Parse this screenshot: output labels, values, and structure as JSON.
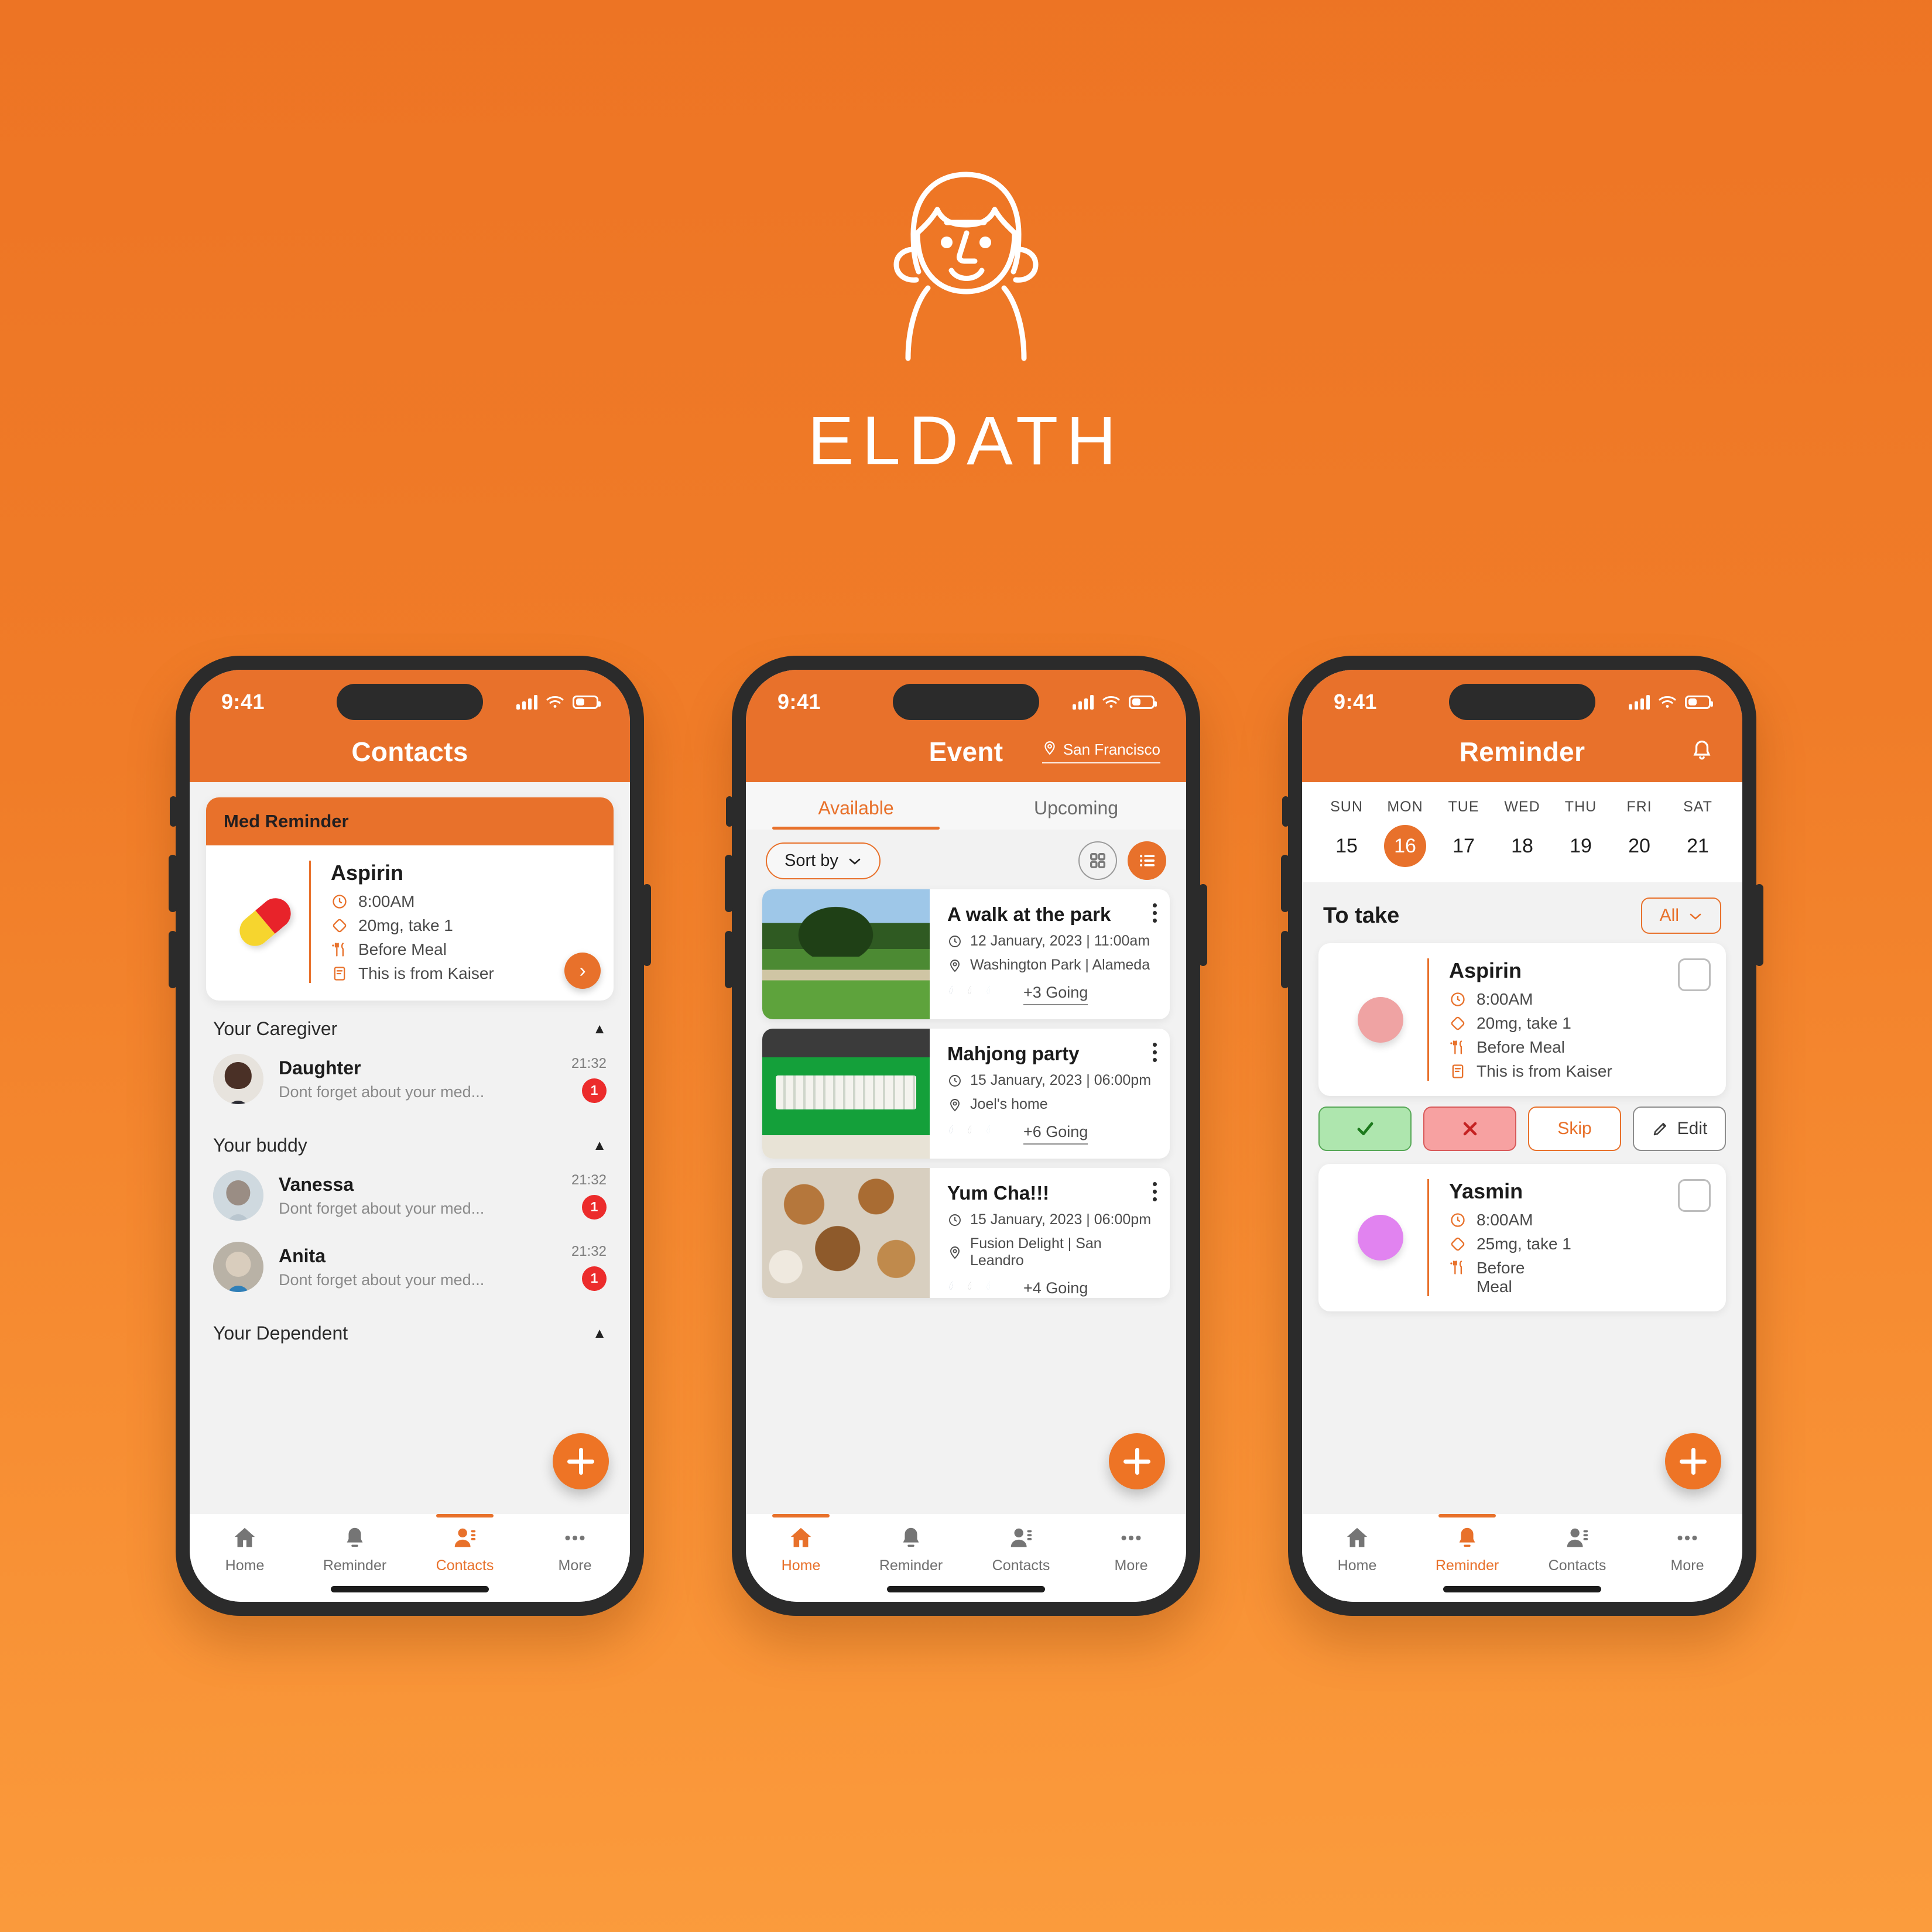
{
  "brand": {
    "name": "ELDATH",
    "logo_icon": "elderly-person-line-icon",
    "bg_top": "#ED7424",
    "bg_bottom": "#FB9C3D",
    "accent": "#E8712B"
  },
  "status_bar": {
    "time": "9:41",
    "signal_icon": "cellular-bars-icon",
    "wifi_icon": "wifi-icon",
    "battery_icon": "battery-icon"
  },
  "nav": {
    "items": [
      {
        "label": "Home",
        "icon": "home-icon"
      },
      {
        "label": "Reminder",
        "icon": "bell-icon"
      },
      {
        "label": "Contacts",
        "icon": "contacts-icon"
      },
      {
        "label": "More",
        "icon": "ellipsis-icon"
      }
    ]
  },
  "screen1": {
    "title": "Contacts",
    "active_nav": "Contacts",
    "med_reminder": {
      "header": "Med Reminder",
      "pill_icon": "capsule-pill-icon",
      "name": "Aspirin",
      "time": "8:00AM",
      "dose": "20mg, take 1",
      "meal": "Before Meal",
      "note": "This is from Kaiser",
      "chevron_icon": "chevron-right-icon"
    },
    "groups": [
      {
        "title": "Your Caregiver",
        "caret_icon": "caret-up-icon",
        "contacts": [
          {
            "name": "Daughter",
            "message": "Dont forget about your med...",
            "time": "21:32",
            "badge": "1",
            "avatar": "avatar-daughter"
          }
        ]
      },
      {
        "title": "Your buddy",
        "caret_icon": "caret-up-icon",
        "contacts": [
          {
            "name": "Vanessa",
            "message": "Dont forget about your med...",
            "time": "21:32",
            "badge": "1",
            "avatar": "avatar-vanessa"
          },
          {
            "name": "Anita",
            "message": "Dont forget about your med...",
            "time": "21:32",
            "badge": "1",
            "avatar": "avatar-anita"
          }
        ]
      },
      {
        "title": "Your Dependent",
        "caret_icon": "caret-up-icon",
        "contacts": []
      }
    ],
    "fab_icon": "plus-icon"
  },
  "screen2": {
    "title": "Event",
    "location": "San Francisco",
    "location_icon": "map-pin-icon",
    "active_nav": "Home",
    "tabs": [
      {
        "label": "Available",
        "active": true
      },
      {
        "label": "Upcoming",
        "active": false
      }
    ],
    "sort_by": "Sort by",
    "sort_caret_icon": "chevron-down-icon",
    "view_grid_icon": "grid-view-icon",
    "view_list_icon": "list-view-icon",
    "events": [
      {
        "title": "A walk at the park",
        "datetime": "12 January, 2023 | 11:00am",
        "place": "Washington Park | Alameda",
        "going": "+3 Going",
        "thumb": "park-photo",
        "clock_icon": "clock-icon",
        "pin_icon": "map-pin-icon",
        "menu_icon": "kebab-menu-icon"
      },
      {
        "title": "Mahjong party",
        "datetime": "15 January, 2023 | 06:00pm",
        "place": "Joel's home",
        "going": "+6 Going",
        "thumb": "mahjong-photo",
        "clock_icon": "clock-icon",
        "pin_icon": "map-pin-icon",
        "menu_icon": "kebab-menu-icon"
      },
      {
        "title": "Yum Cha!!!",
        "datetime": "15 January, 2023 | 06:00pm",
        "place": "Fusion Delight | San Leandro",
        "going": "+4 Going",
        "thumb": "dimsum-photo",
        "clock_icon": "clock-icon",
        "pin_icon": "map-pin-icon",
        "menu_icon": "kebab-menu-icon"
      }
    ],
    "fab_icon": "plus-icon"
  },
  "screen3": {
    "title": "Reminder",
    "bell_icon": "bell-outline-icon",
    "active_nav": "Reminder",
    "calendar": {
      "days": [
        "SUN",
        "MON",
        "TUE",
        "WED",
        "THU",
        "FRI",
        "SAT"
      ],
      "dates": [
        "15",
        "16",
        "17",
        "18",
        "19",
        "20",
        "21"
      ],
      "selected_index": 1
    },
    "section_title": "To take",
    "filter": "All",
    "filter_caret_icon": "chevron-down-icon",
    "meds": [
      {
        "name": "Aspirin",
        "time": "8:00AM",
        "dose": "20mg, take 1",
        "meal": "Before Meal",
        "note": "This is from Kaiser",
        "pill_color": "#EFA3A3",
        "checkbox": "unchecked"
      },
      {
        "name": "Yasmin",
        "time": "8:00AM",
        "dose": "25mg, take 1",
        "meal": "Before Meal",
        "note": "",
        "pill_color": "#E183F0",
        "checkbox": "unchecked"
      }
    ],
    "actions": {
      "taken_icon": "check-icon",
      "missed_icon": "cross-icon",
      "skip_label": "Skip",
      "edit_label": "Edit",
      "edit_icon": "pencil-icon"
    },
    "fab_icon": "plus-icon"
  }
}
